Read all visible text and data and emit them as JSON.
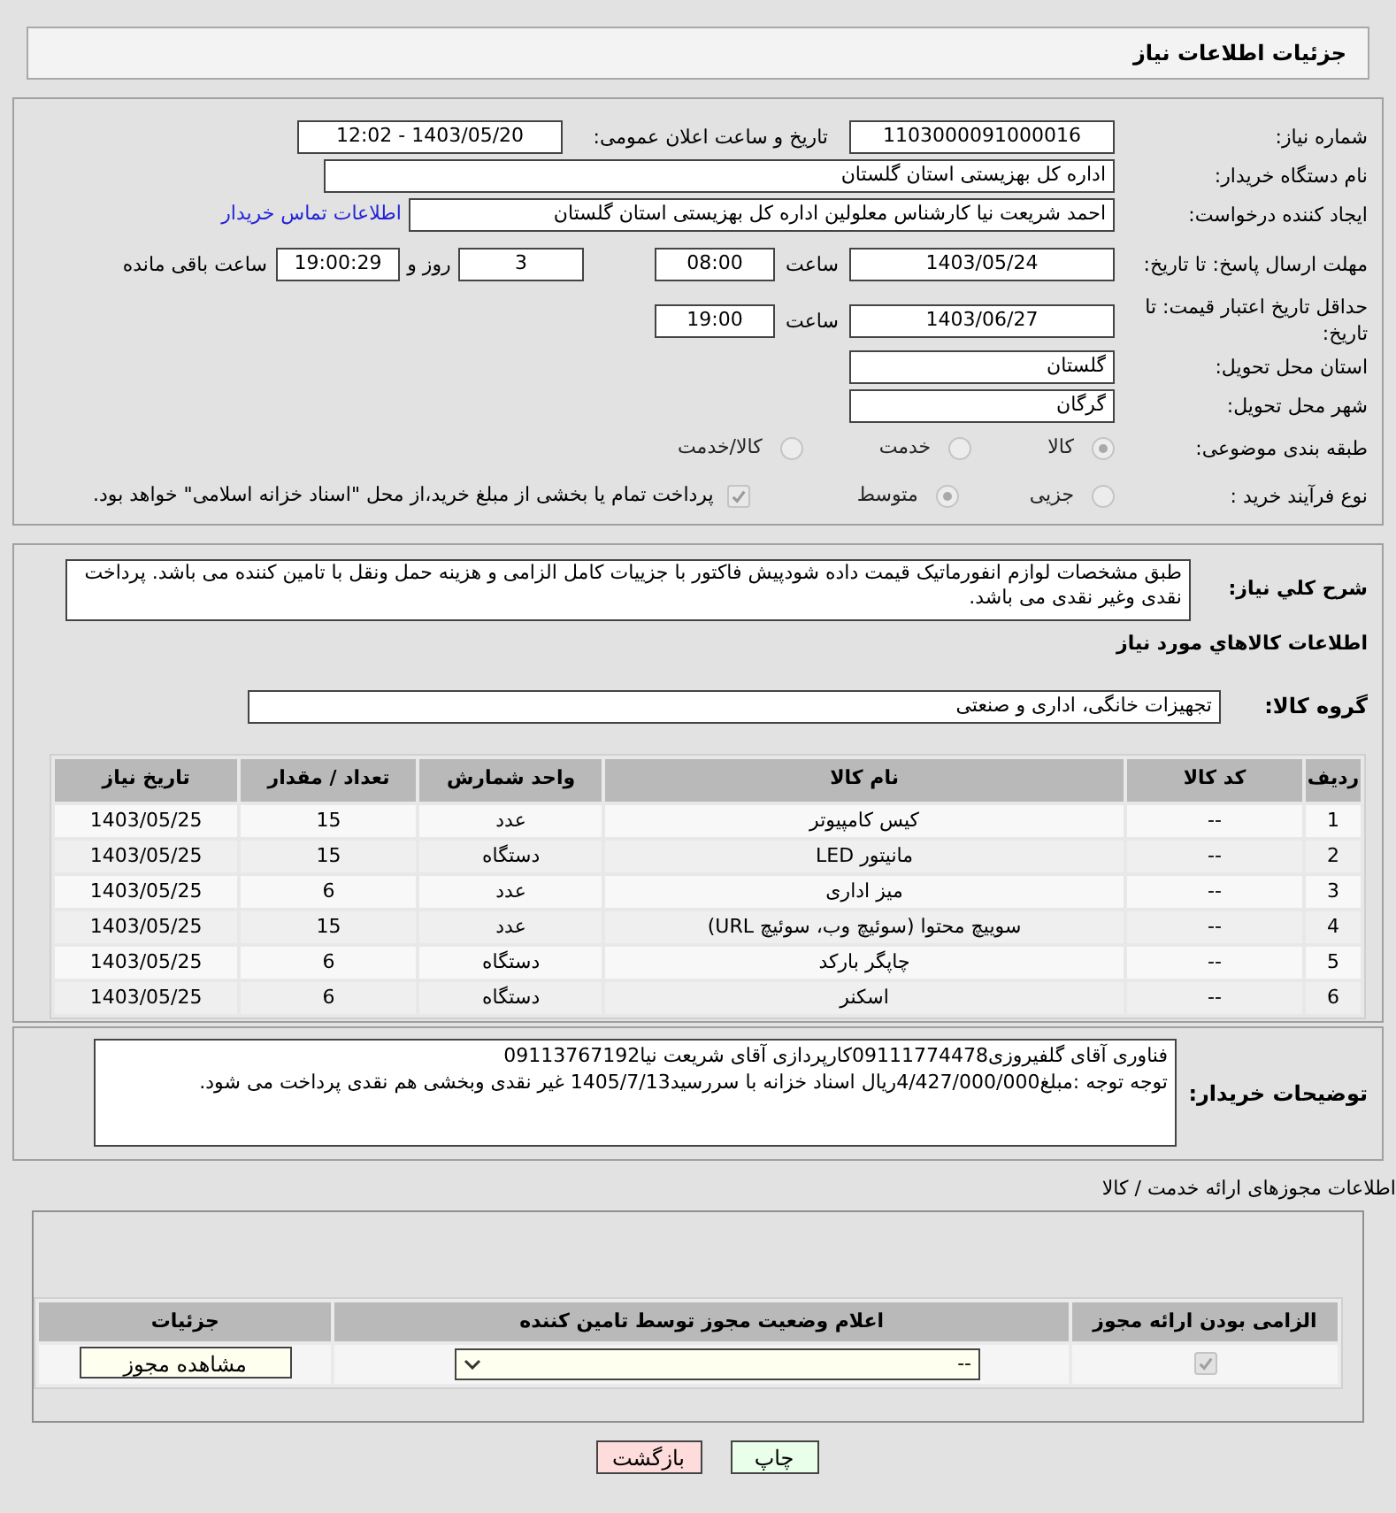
{
  "header": {
    "title": "جزئیات اطلاعات نیاز"
  },
  "details": {
    "need_number": {
      "label": "شماره نیاز:",
      "value": "1103000091000016"
    },
    "announcement": {
      "label": "تاریخ و ساعت اعلان عمومی:",
      "value": "1403/05/20 - 12:02"
    },
    "buyer": {
      "label": "نام دستگاه خریدار:",
      "value": "اداره کل بهزیستی استان گلستان"
    },
    "requester": {
      "label": "ایجاد کننده درخواست:",
      "value": "احمد شریعت نیا کارشناس معلولین اداره کل بهزیستی استان گلستان",
      "link": "اطلاعات تماس خریدار"
    },
    "deadline": {
      "label": "مهلت ارسال پاسخ: تا تاریخ:",
      "date": "1403/05/24",
      "time_label": "ساعت",
      "time": "08:00",
      "days": "3",
      "days_label": "روز و",
      "remaining": "19:00:29",
      "remaining_label": "ساعت باقی مانده"
    },
    "validity": {
      "label": "حداقل تاریخ اعتبار قیمت: تا تاریخ:",
      "date": "1403/06/27",
      "time_label": "ساعت",
      "time": "19:00"
    },
    "province": {
      "label": "استان محل تحویل:",
      "value": "گلستان"
    },
    "city": {
      "label": "شهر محل تحویل:",
      "value": "گرگان"
    },
    "category": {
      "label": "طبقه بندی موضوعی:",
      "options": [
        {
          "label": "کالا",
          "selected": true
        },
        {
          "label": "خدمت",
          "selected": false
        },
        {
          "label": "کالا/خدمت",
          "selected": false
        }
      ]
    },
    "process": {
      "label": "نوع فرآیند خرید :",
      "options": [
        {
          "label": "جزیی",
          "selected": false
        },
        {
          "label": "متوسط",
          "selected": true
        }
      ],
      "treasury": {
        "label": "پرداخت تمام یا بخشی از مبلغ خرید،از محل \"اسناد خزانه اسلامی\" خواهد بود.",
        "checked": true
      }
    }
  },
  "description": {
    "label": "شرح کلي نياز:",
    "value": "طبق مشخصات لوازم انفورماتیک قیمت داده شودپیش فاکتور با جزییات کامل الزامی و هزینه حمل ونقل با تامین کننده می باشد. پرداخت نقدی وغیر نقدی می باشد."
  },
  "goods": {
    "title": "اطلاعات کالاهاي مورد نياز",
    "group_label": "گروه کالا:",
    "group_value": "تجهیزات خانگی، اداری و صنعتی",
    "columns": [
      "ردیف",
      "کد کالا",
      "نام کالا",
      "واحد شمارش",
      "تعداد / مقدار",
      "تاریخ نیاز"
    ],
    "rows": [
      [
        "1",
        "--",
        "کیس کامپیوتر",
        "عدد",
        "15",
        "1403/05/25"
      ],
      [
        "2",
        "--",
        "مانیتور LED",
        "دستگاه",
        "15",
        "1403/05/25"
      ],
      [
        "3",
        "--",
        "میز اداری",
        "عدد",
        "6",
        "1403/05/25"
      ],
      [
        "4",
        "--",
        "سوییچ محتوا (سوئیچ وب، سوئیچ URL)",
        "عدد",
        "15",
        "1403/05/25"
      ],
      [
        "5",
        "--",
        "چاپگر بارکد",
        "دستگاه",
        "6",
        "1403/05/25"
      ],
      [
        "6",
        "--",
        "اسکنر",
        "دستگاه",
        "6",
        "1403/05/25"
      ]
    ]
  },
  "buyer_notes": {
    "label": "توضیحات خریدار:",
    "lines": [
      "فناوری آقای گلفیروزی09111774478کارپردازی آقای شریعت نیا09113767192",
      "توجه توجه :مبلغ4/427/000/000ریال اسناد خزانه با سررسید1405/7/13 غیر نقدی وبخشی هم نقدی پرداخت می شود."
    ]
  },
  "permits": {
    "title": "اطلاعات مجوزهای ارائه خدمت / کالا",
    "columns": [
      "الزامی بودن ارائه مجوز",
      "اعلام وضعیت مجوز توسط تامین کننده",
      "جزئیات"
    ],
    "row": {
      "required": true,
      "status": "--",
      "details_button": "مشاهده مجوز"
    }
  },
  "buttons": [
    {
      "label": "چاپ",
      "kind": "print"
    },
    {
      "label": "بازگشت",
      "kind": "back"
    }
  ]
}
